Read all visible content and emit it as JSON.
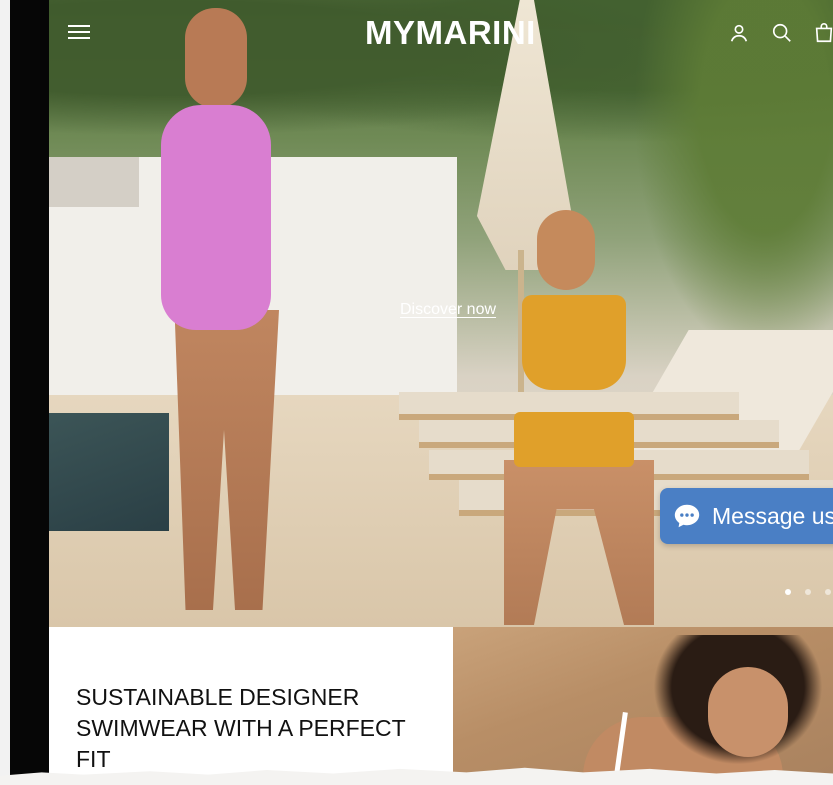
{
  "header": {
    "logo": "MYMARINI",
    "menu_icon": "hamburger-menu-icon",
    "account_icon": "user-icon",
    "search_icon": "search-icon",
    "cart_icon": "cart-bag-icon"
  },
  "hero": {
    "cta_label": "Discover now",
    "slide_count": 3,
    "active_slide": 1
  },
  "chat": {
    "label": "Message us",
    "icon": "chat-bubble-icon",
    "color": "#4a7fc5"
  },
  "intro": {
    "headline": "SUSTAINABLE DESIGNER SWIMWEAR WITH A PERFECT FIT"
  },
  "colors": {
    "text_dark": "#111111",
    "white": "#ffffff"
  }
}
